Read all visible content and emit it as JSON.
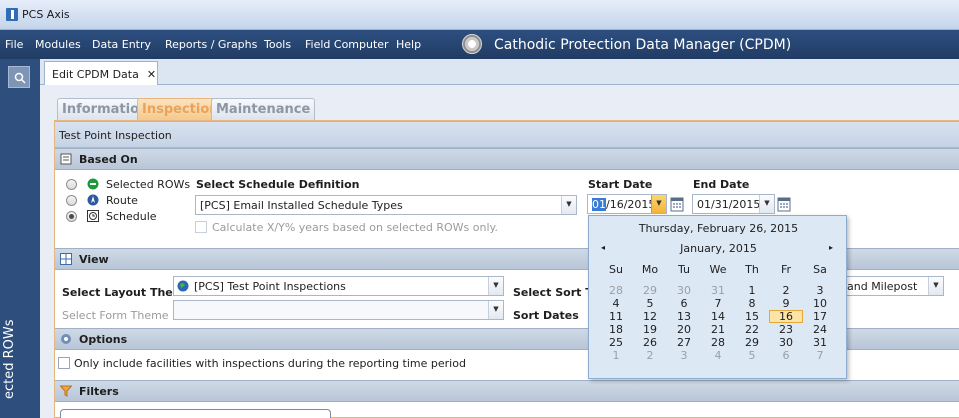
{
  "app_title": "PCS Axis",
  "menu": [
    "File",
    "Modules",
    "Data Entry",
    "Reports / Graphs",
    "Tools",
    "Field Computer",
    "Help"
  ],
  "module_title": "Cathodic Protection Data Manager (CPDM)",
  "left_panel_label": "ected ROWs",
  "document_tab": {
    "label": "Edit CPDM Data",
    "close": "✕"
  },
  "page_tabs": [
    "Information",
    "Inspection",
    "Maintenance"
  ],
  "panel_title": "Test Point Inspection",
  "based_on": {
    "title": "Based On",
    "options": [
      "Selected ROWs",
      "Route",
      "Schedule"
    ],
    "schedule_label": "Select Schedule Definition",
    "schedule_value": "[PCS] Email Installed Schedule Types",
    "calc_label": "Calculate X/Y% years based on selected ROWs only.",
    "start_label": "Start Date",
    "start_sel": "01",
    "start_rest": "/16/2015",
    "end_label": "End Date",
    "end_value": "01/31/2015"
  },
  "view": {
    "title": "View",
    "layout_label": "Select Layout Theme",
    "layout_value": "[PCS] Test Point Inspections",
    "form_label": "Select Form Theme",
    "sort_label": "Select Sort The",
    "sort_value": "and Milepost",
    "sort_dates_label": "Sort Dates"
  },
  "options": {
    "title": "Options",
    "checkbox_label": "Only include facilities with inspections during the reporting time period"
  },
  "filters": {
    "title": "Filters"
  },
  "calendar": {
    "today_text": "Thursday, February 26, 2015",
    "month_text": "January, 2015",
    "prev": "◂",
    "next": "▸",
    "days_of_week": [
      "Su",
      "Mo",
      "Tu",
      "We",
      "Th",
      "Fr",
      "Sa"
    ],
    "weeks": [
      [
        "28",
        "29",
        "30",
        "31",
        "1",
        "2",
        "3"
      ],
      [
        "4",
        "5",
        "6",
        "7",
        "8",
        "9",
        "10"
      ],
      [
        "11",
        "12",
        "13",
        "14",
        "15",
        "16",
        "17"
      ],
      [
        "18",
        "19",
        "20",
        "21",
        "22",
        "23",
        "24"
      ],
      [
        "25",
        "26",
        "27",
        "28",
        "29",
        "30",
        "31"
      ],
      [
        "1",
        "2",
        "3",
        "4",
        "5",
        "6",
        "7"
      ]
    ],
    "selected_day": "16"
  },
  "colors": {
    "menubar": "#213c64",
    "active_tab": "#f6c98e",
    "selected_day": "#fbe4a6"
  }
}
